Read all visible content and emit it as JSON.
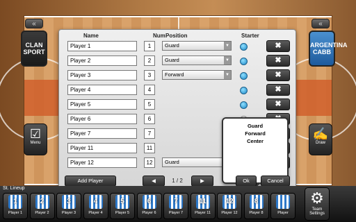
{
  "left_panel": {
    "chevron_glyph": "«",
    "team_logo_text": "CLAN SPORT",
    "menu_label": "Menu",
    "menu_icon_glyph": "☑"
  },
  "right_panel": {
    "chevron_glyph": "«",
    "team_logo_text": "ARGENTINA CABB",
    "draw_label": "Draw",
    "draw_icon_glyph": "✍"
  },
  "dialog": {
    "headers": {
      "name": "Name",
      "num": "Num",
      "position": "Position",
      "starter": "Starter"
    },
    "rows": [
      {
        "name": "Player 1",
        "num": "1",
        "position": "Guard",
        "starter": true,
        "delete_glyph": "✖"
      },
      {
        "name": "Player 2",
        "num": "2",
        "position": "Guard",
        "starter": true,
        "delete_glyph": "✖"
      },
      {
        "name": "Player 3",
        "num": "3",
        "position": "Forward",
        "starter": true,
        "delete_glyph": "✖"
      },
      {
        "name": "Player 4",
        "num": "4",
        "position": "",
        "starter": true,
        "delete_glyph": "✖"
      },
      {
        "name": "Player 5",
        "num": "5",
        "position": "",
        "starter": true,
        "delete_glyph": "✖"
      },
      {
        "name": "Player 6",
        "num": "6",
        "position": "",
        "starter": false,
        "delete_glyph": "✖"
      },
      {
        "name": "Player 7",
        "num": "7",
        "position": "",
        "starter": false,
        "delete_glyph": "✖"
      },
      {
        "name": "Player 11",
        "num": "11",
        "position": "",
        "starter": false,
        "delete_glyph": "✖"
      },
      {
        "name": "Player 12",
        "num": "12",
        "position": "Guard",
        "starter": false,
        "delete_glyph": "✖"
      }
    ],
    "position_popup": {
      "options": [
        "Guard",
        "Forward",
        "Center"
      ]
    },
    "add_player_label": "Add Player",
    "prev_glyph": "◀",
    "next_glyph": "▶",
    "page_indicator": "1 / 2",
    "ok_label": "Ok",
    "cancel_label": "Cancel"
  },
  "lineup": {
    "title": "St. Lineup",
    "players": [
      {
        "num": "1",
        "label": "Player 1"
      },
      {
        "num": "2",
        "label": "Player 2"
      },
      {
        "num": "3",
        "label": "Player 3"
      },
      {
        "num": "4",
        "label": "Player 4"
      },
      {
        "num": "5",
        "label": "Player 5"
      },
      {
        "num": "6",
        "label": "Player 6"
      },
      {
        "num": "7",
        "label": "Player 7"
      },
      {
        "num": "11",
        "label": "Player 11"
      },
      {
        "num": "12",
        "label": "Player 12"
      },
      {
        "num": "8",
        "label": "Player 8"
      },
      {
        "num": "",
        "label": "Player"
      }
    ],
    "settings_label": "Team Settings",
    "settings_icon_glyph": "⚙"
  },
  "colors": {
    "starter_on": "#1c86c7",
    "jersey": "#2d78c8",
    "key_paint": "#d0602c"
  }
}
